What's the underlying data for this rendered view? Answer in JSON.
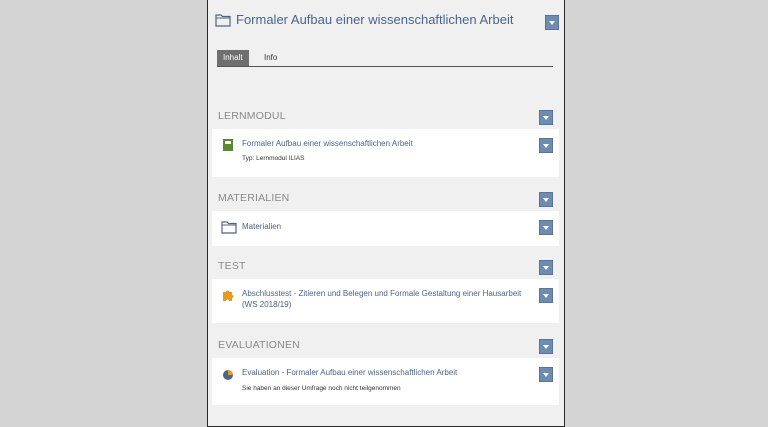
{
  "header": {
    "title": "Formaler Aufbau einer wissenschaftlichen Arbeit",
    "icon": "folder-icon"
  },
  "tabs": [
    {
      "label": "Inhalt",
      "active": true
    },
    {
      "label": "Info",
      "active": false
    }
  ],
  "sections": {
    "lernmodul": {
      "title": "LERNMODUL",
      "item": {
        "icon": "learning-module-icon",
        "title": "Formaler Aufbau einer wissenschaftlichen Arbeit",
        "meta": "Typ: Lernmodul ILIAS"
      }
    },
    "materialien": {
      "title": "MATERIALIEN",
      "item": {
        "icon": "folder-icon",
        "title": "Materialien"
      }
    },
    "test": {
      "title": "TEST",
      "item": {
        "icon": "puzzle-icon",
        "title": "Abschlusstest - Zitieren und Belegen und Formale Gestaltung einer Hausarbeit (WS 2018/19)"
      }
    },
    "evaluationen": {
      "title": "EVALUATIONEN",
      "item": {
        "icon": "survey-pie-icon",
        "title": "Evaluation - Formaler Aufbau einer wissenschaftlichen Arbeit",
        "meta": "Sie haben an dieser Umfrage noch nicht teilgenommen"
      }
    }
  },
  "colors": {
    "accent": "#4c6586",
    "button": "#6e8bb0",
    "module_green": "#5b8a2e",
    "puzzle_orange": "#e89a1c"
  }
}
